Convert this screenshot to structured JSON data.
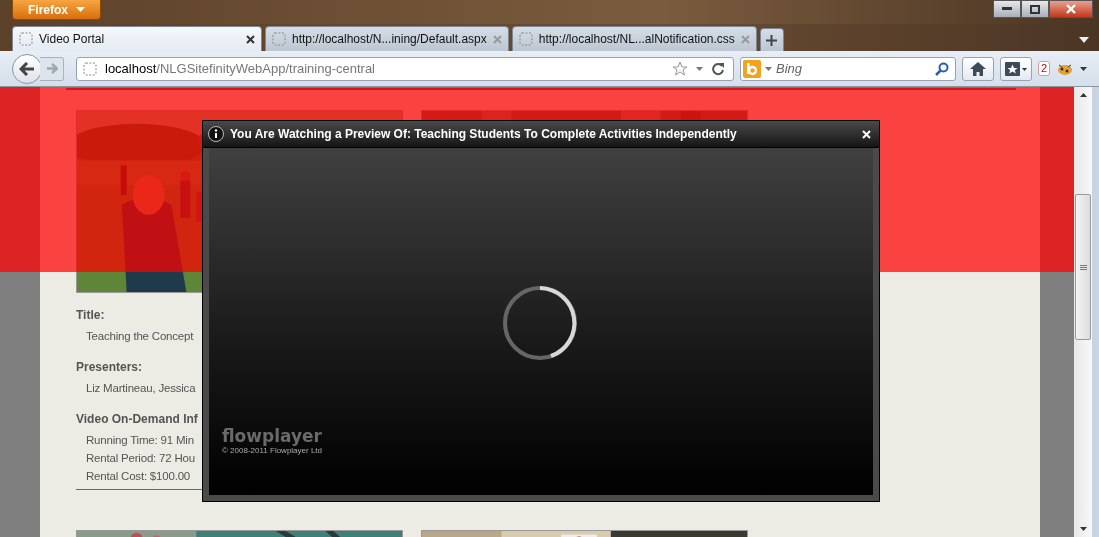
{
  "browser": {
    "menu_button": "Firefox",
    "tabs": [
      {
        "label": "Video Portal",
        "selected": true
      },
      {
        "label": "http://localhost/N...ining/Default.aspx",
        "selected": false
      },
      {
        "label": "http://localhost/NL...alNotification.css",
        "selected": false
      }
    ],
    "address": {
      "host": "localhost",
      "path": "/NLGSitefinityWebApp/training-central"
    },
    "search": {
      "placeholder": "Bing"
    },
    "addon_badge": "2"
  },
  "video": {
    "sections": [
      {
        "heading": "Title:",
        "lines": [
          "Teaching the Concept"
        ]
      },
      {
        "heading": "Presenters:",
        "lines": [
          "Liz Martineau, Jessica"
        ]
      },
      {
        "heading": "Video On-Demand Inf",
        "lines": [
          "Running Time: 91 Min",
          "Rental Period: 72 Hou",
          "Rental Cost: $100.00"
        ]
      }
    ]
  },
  "modal": {
    "title": "You Are Watching a Preview Of: Teaching Students To Complete Activities Independently",
    "player": {
      "logo": "flowplayer",
      "copyright": "© 2008-2011 Flowplayer Ltd"
    }
  }
}
